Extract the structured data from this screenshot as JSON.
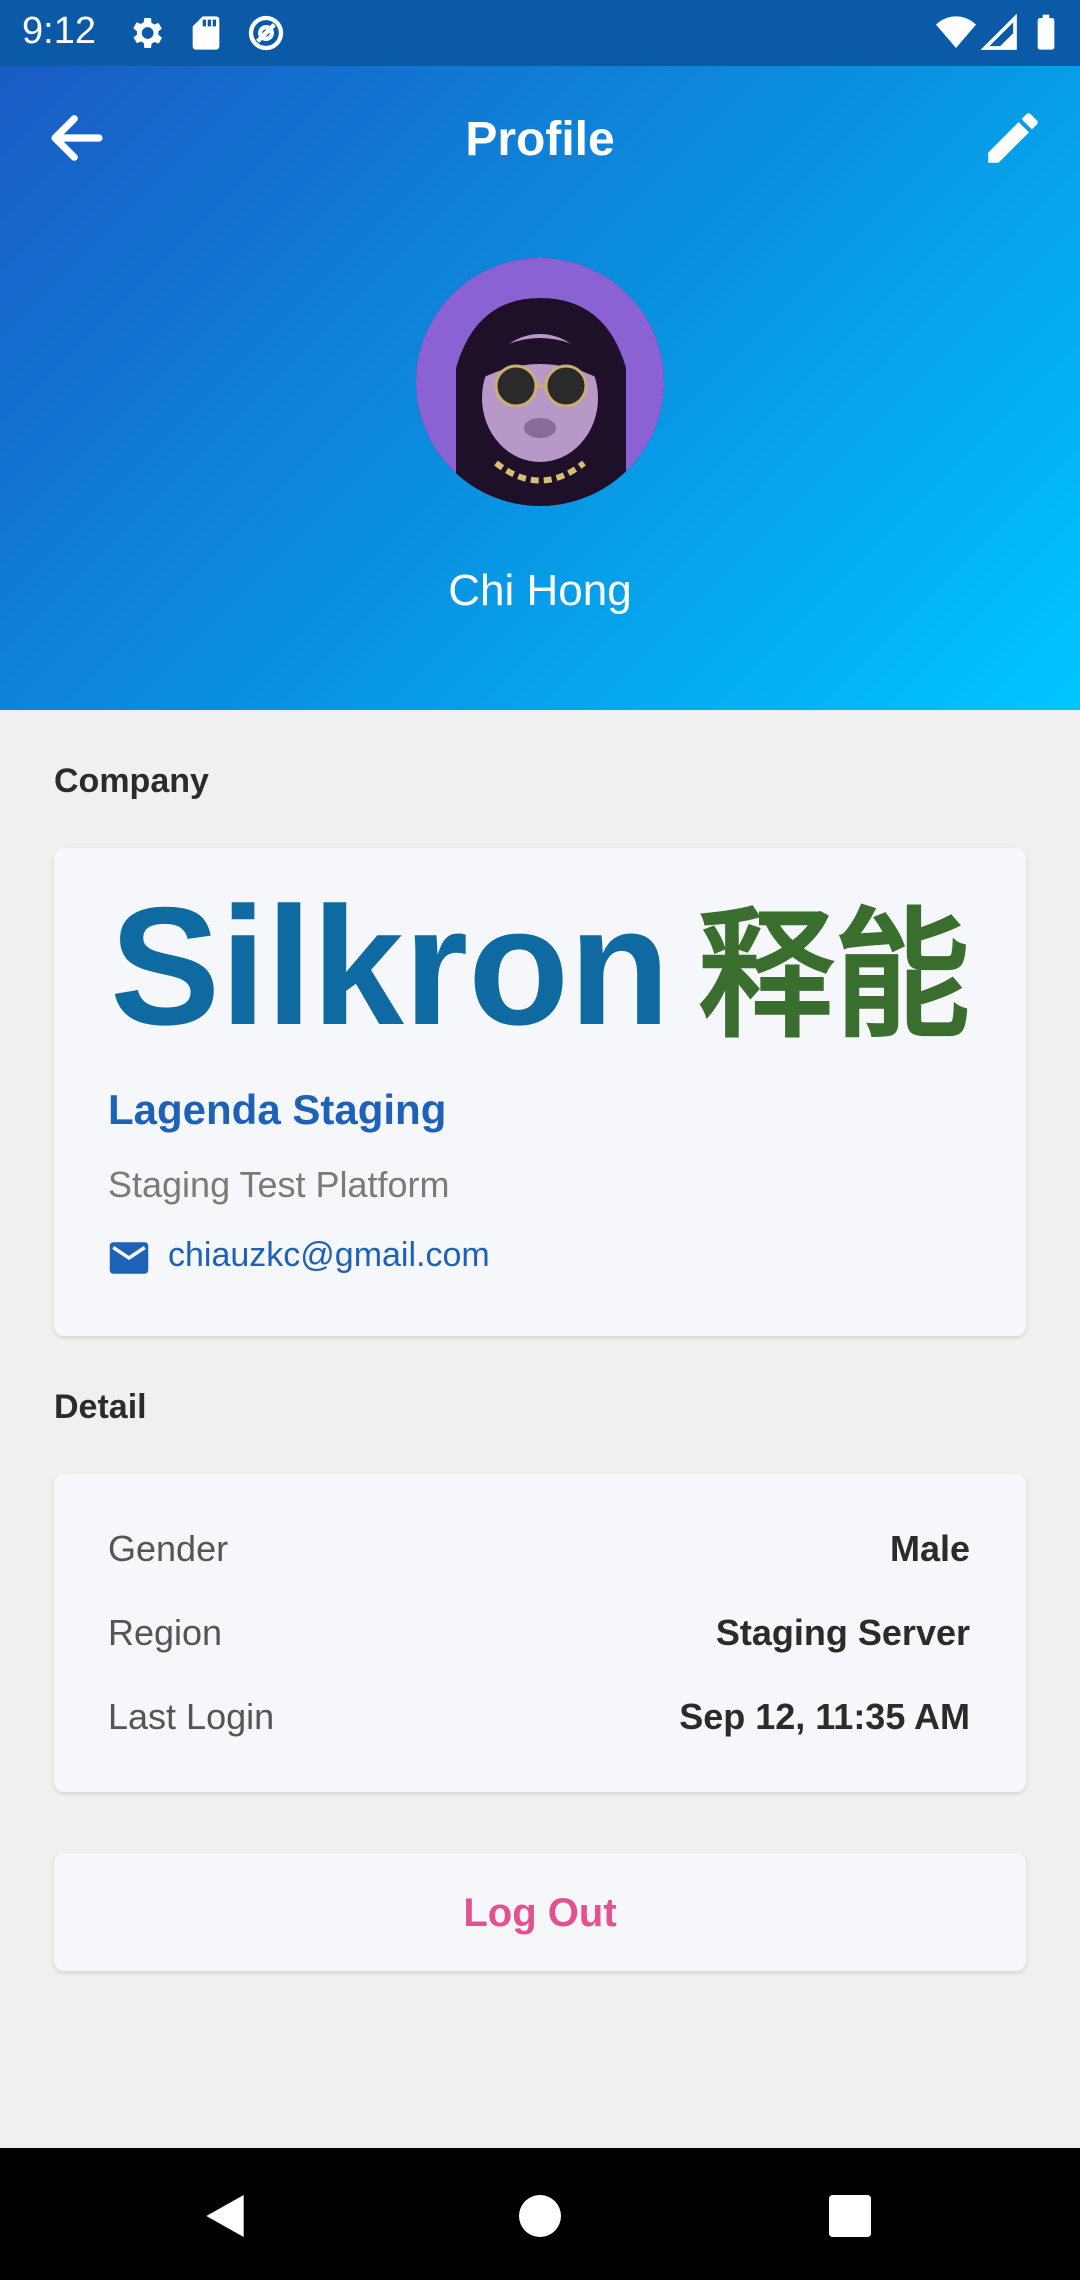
{
  "status_bar": {
    "time": "9:12",
    "icons": [
      "settings-icon",
      "sd-card-icon",
      "at-sign-icon",
      "wifi-icon",
      "signal-icon",
      "battery-icon"
    ]
  },
  "header": {
    "title": "Profile",
    "back_icon": "arrow-left-icon",
    "edit_icon": "pencil-icon"
  },
  "profile": {
    "name": "Chi Hong"
  },
  "company_section": {
    "label": "Company",
    "logo_text": "Silkron",
    "logo_cjk": "释能",
    "company_name": "Lagenda Staging",
    "subtitle": "Staging Test Platform",
    "email": "chiauzkc@gmail.com"
  },
  "detail_section": {
    "label": "Detail",
    "rows": [
      {
        "label": "Gender",
        "value": "Male"
      },
      {
        "label": "Region",
        "value": "Staging Server"
      },
      {
        "label": "Last Login",
        "value": "Sep 12, 11:35 AM"
      }
    ]
  },
  "logout": {
    "label": "Log Out"
  },
  "colors": {
    "accent": "#1e62b8",
    "logout": "#e3528f",
    "logo_blue": "#0e6aa0",
    "logo_green": "#3a6e2e"
  }
}
